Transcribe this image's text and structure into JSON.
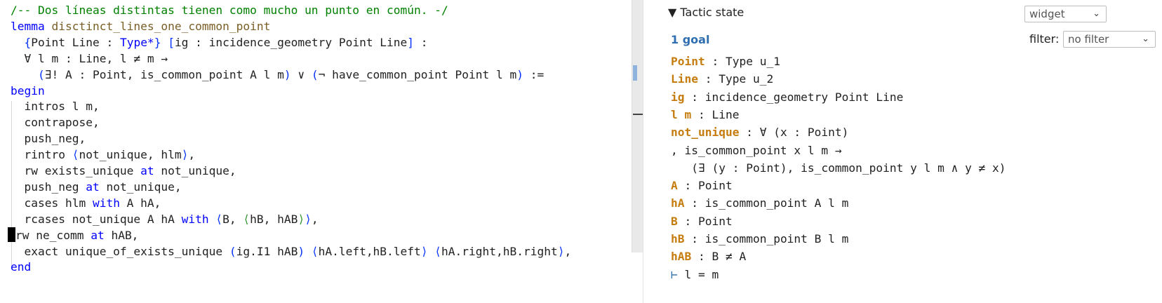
{
  "editor": {
    "lines": [
      [
        {
          "t": "/-- Dos líneas distintas tienen como mucho un punto en común. -/",
          "c": "comment"
        }
      ],
      [
        {
          "t": "lemma",
          "c": "kw"
        },
        {
          "t": " "
        },
        {
          "t": "disctinct_lines_one_common_point",
          "c": "name"
        }
      ],
      [
        {
          "t": "  "
        },
        {
          "t": "{",
          "c": "br"
        },
        {
          "t": "Point Line : "
        },
        {
          "t": "Type*",
          "c": "kw"
        },
        {
          "t": "}",
          "c": "br"
        },
        {
          "t": " "
        },
        {
          "t": "[",
          "c": "br"
        },
        {
          "t": "ig : incidence_geometry Point Line"
        },
        {
          "t": "]",
          "c": "br"
        },
        {
          "t": " :"
        }
      ],
      [
        {
          "t": "  ∀ l m : Line, l ≠ m →"
        }
      ],
      [
        {
          "t": "    "
        },
        {
          "t": "(",
          "c": "br"
        },
        {
          "t": "∃! A : Point, is_common_point A l m"
        },
        {
          "t": ")",
          "c": "br"
        },
        {
          "t": " ∨ "
        },
        {
          "t": "(",
          "c": "br"
        },
        {
          "t": "¬ have_common_point Point l m"
        },
        {
          "t": ")",
          "c": "br"
        },
        {
          "t": " :="
        }
      ],
      [
        {
          "t": "begin",
          "c": "kw"
        }
      ],
      [
        {
          "t": "  intros l m,"
        }
      ],
      [
        {
          "t": "  contrapose,"
        }
      ],
      [
        {
          "t": "  push_neg,"
        }
      ],
      [
        {
          "t": "  rintro "
        },
        {
          "t": "⟨",
          "c": "br"
        },
        {
          "t": "not_unique, hlm"
        },
        {
          "t": "⟩",
          "c": "br"
        },
        {
          "t": ","
        }
      ],
      [
        {
          "t": "  rw exists_unique "
        },
        {
          "t": "at",
          "c": "kw"
        },
        {
          "t": " not_unique,"
        }
      ],
      [
        {
          "t": "  push_neg "
        },
        {
          "t": "at",
          "c": "kw"
        },
        {
          "t": " not_unique,"
        }
      ],
      [
        {
          "t": "  cases hlm "
        },
        {
          "t": "with",
          "c": "kw"
        },
        {
          "t": " A hA,"
        }
      ],
      [
        {
          "t": "  rcases not_unique A hA "
        },
        {
          "t": "with",
          "c": "kw"
        },
        {
          "t": " "
        },
        {
          "t": "⟨",
          "c": "br"
        },
        {
          "t": "B, "
        },
        {
          "t": "⟨",
          "c": "br2"
        },
        {
          "t": "hB, hAB"
        },
        {
          "t": "⟩",
          "c": "br2"
        },
        {
          "t": "⟩",
          "c": "br"
        },
        {
          "t": ","
        }
      ],
      [
        {
          "t": "CARET",
          "c": "caret"
        },
        {
          "t": "rw ne_comm "
        },
        {
          "t": "at",
          "c": "kw"
        },
        {
          "t": " hAB,"
        }
      ],
      [
        {
          "t": "  exact unique_of_exists_unique "
        },
        {
          "t": "(",
          "c": "br"
        },
        {
          "t": "ig.I1 hAB"
        },
        {
          "t": ")",
          "c": "br"
        },
        {
          "t": " "
        },
        {
          "t": "⟨",
          "c": "br"
        },
        {
          "t": "hA.left,hB.left"
        },
        {
          "t": "⟩",
          "c": "br"
        },
        {
          "t": " "
        },
        {
          "t": "⟨",
          "c": "br"
        },
        {
          "t": "hA.right,hB.right"
        },
        {
          "t": "⟩",
          "c": "br"
        },
        {
          "t": ","
        }
      ],
      [
        {
          "t": "end",
          "c": "kw"
        }
      ]
    ]
  },
  "panel": {
    "header": "Tactic state",
    "header_toggle_icon": "triangle-down",
    "mode_select": {
      "value": "widget"
    },
    "goal_count": "1 goal",
    "filter_label": "filter:",
    "filter_select": {
      "value": "no filter"
    },
    "hypotheses": [
      [
        {
          "t": "Point",
          "c": "hname"
        },
        {
          "t": " : Type u_1"
        }
      ],
      [
        {
          "t": "Line",
          "c": "hname"
        },
        {
          "t": " : Type u_2"
        }
      ],
      [
        {
          "t": "ig",
          "c": "hname"
        },
        {
          "t": " : incidence_geometry Point Line"
        }
      ],
      [
        {
          "t": "l m",
          "c": "hname"
        },
        {
          "t": " : Line"
        }
      ],
      [
        {
          "t": "not_unique",
          "c": "hname"
        },
        {
          "t": " : ∀ (x : Point)"
        }
      ],
      [
        {
          "t": ", is_common_point x l m →"
        }
      ],
      [
        {
          "t": "   (∃ (y : Point), is_common_point y l m ∧ y ≠ x)"
        }
      ],
      [
        {
          "t": "A",
          "c": "hname"
        },
        {
          "t": " : Point"
        }
      ],
      [
        {
          "t": "hA",
          "c": "hname"
        },
        {
          "t": " : is_common_point A l m"
        }
      ],
      [
        {
          "t": "B",
          "c": "hname"
        },
        {
          "t": " : Point"
        }
      ],
      [
        {
          "t": "hB",
          "c": "hname"
        },
        {
          "t": " : is_common_point B l m"
        }
      ],
      [
        {
          "t": "hAB",
          "c": "hname"
        },
        {
          "t": " : B ≠ A"
        }
      ],
      [
        {
          "t": "⊢",
          "c": "turnstile"
        },
        {
          "t": " l = m"
        }
      ]
    ]
  }
}
